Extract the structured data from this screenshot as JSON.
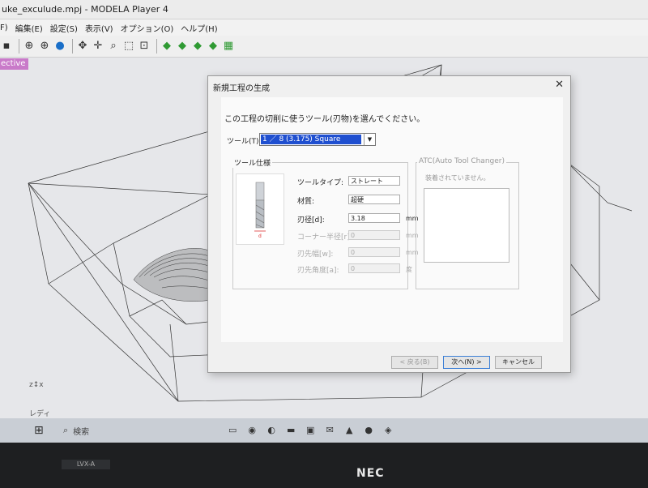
{
  "window": {
    "title": "uke_exculude.mpj - MODELA Player 4"
  },
  "menubar": {
    "items": [
      "F)",
      "編集(E)",
      "設定(S)",
      "表示(V)",
      "オプション(O)",
      "ヘルプ(H)"
    ]
  },
  "viewport": {
    "view_label": "ective",
    "status_text": "レディ"
  },
  "dialog": {
    "title": "新規工程の生成",
    "instruction": "この工程の切削に使うツール(刃物)を選んでください。",
    "tool": {
      "label": "ツール(T):",
      "selected": "1 ／ 8 (3.175) Square"
    },
    "spec": {
      "group_title": "ツール仕様",
      "tool_type": {
        "label": "ツールタイプ:",
        "value": "ストレート"
      },
      "material": {
        "label": "材質:",
        "value": "超硬"
      },
      "diameter": {
        "label": "刃径[d]:",
        "value": "3.18",
        "unit": "mm"
      },
      "corner_radius": {
        "label": "コーナー半径[r]:",
        "value": "0",
        "unit": "mm"
      },
      "tip_width": {
        "label": "刃先幅[w]:",
        "value": "0",
        "unit": "mm"
      },
      "tip_angle": {
        "label": "刃先角度[a]:",
        "value": "0",
        "unit": "度"
      },
      "image_label": "d"
    },
    "atc": {
      "group_title": "ATC(Auto Tool Changer)",
      "note": "装着されていません。"
    },
    "buttons": {
      "back": "< 戻る(B)",
      "next": "次へ(N) >",
      "cancel": "キャンセル"
    }
  },
  "taskbar": {
    "search_label": "検索"
  },
  "bezel": {
    "model": "LVX-A",
    "brand": "NEC"
  }
}
